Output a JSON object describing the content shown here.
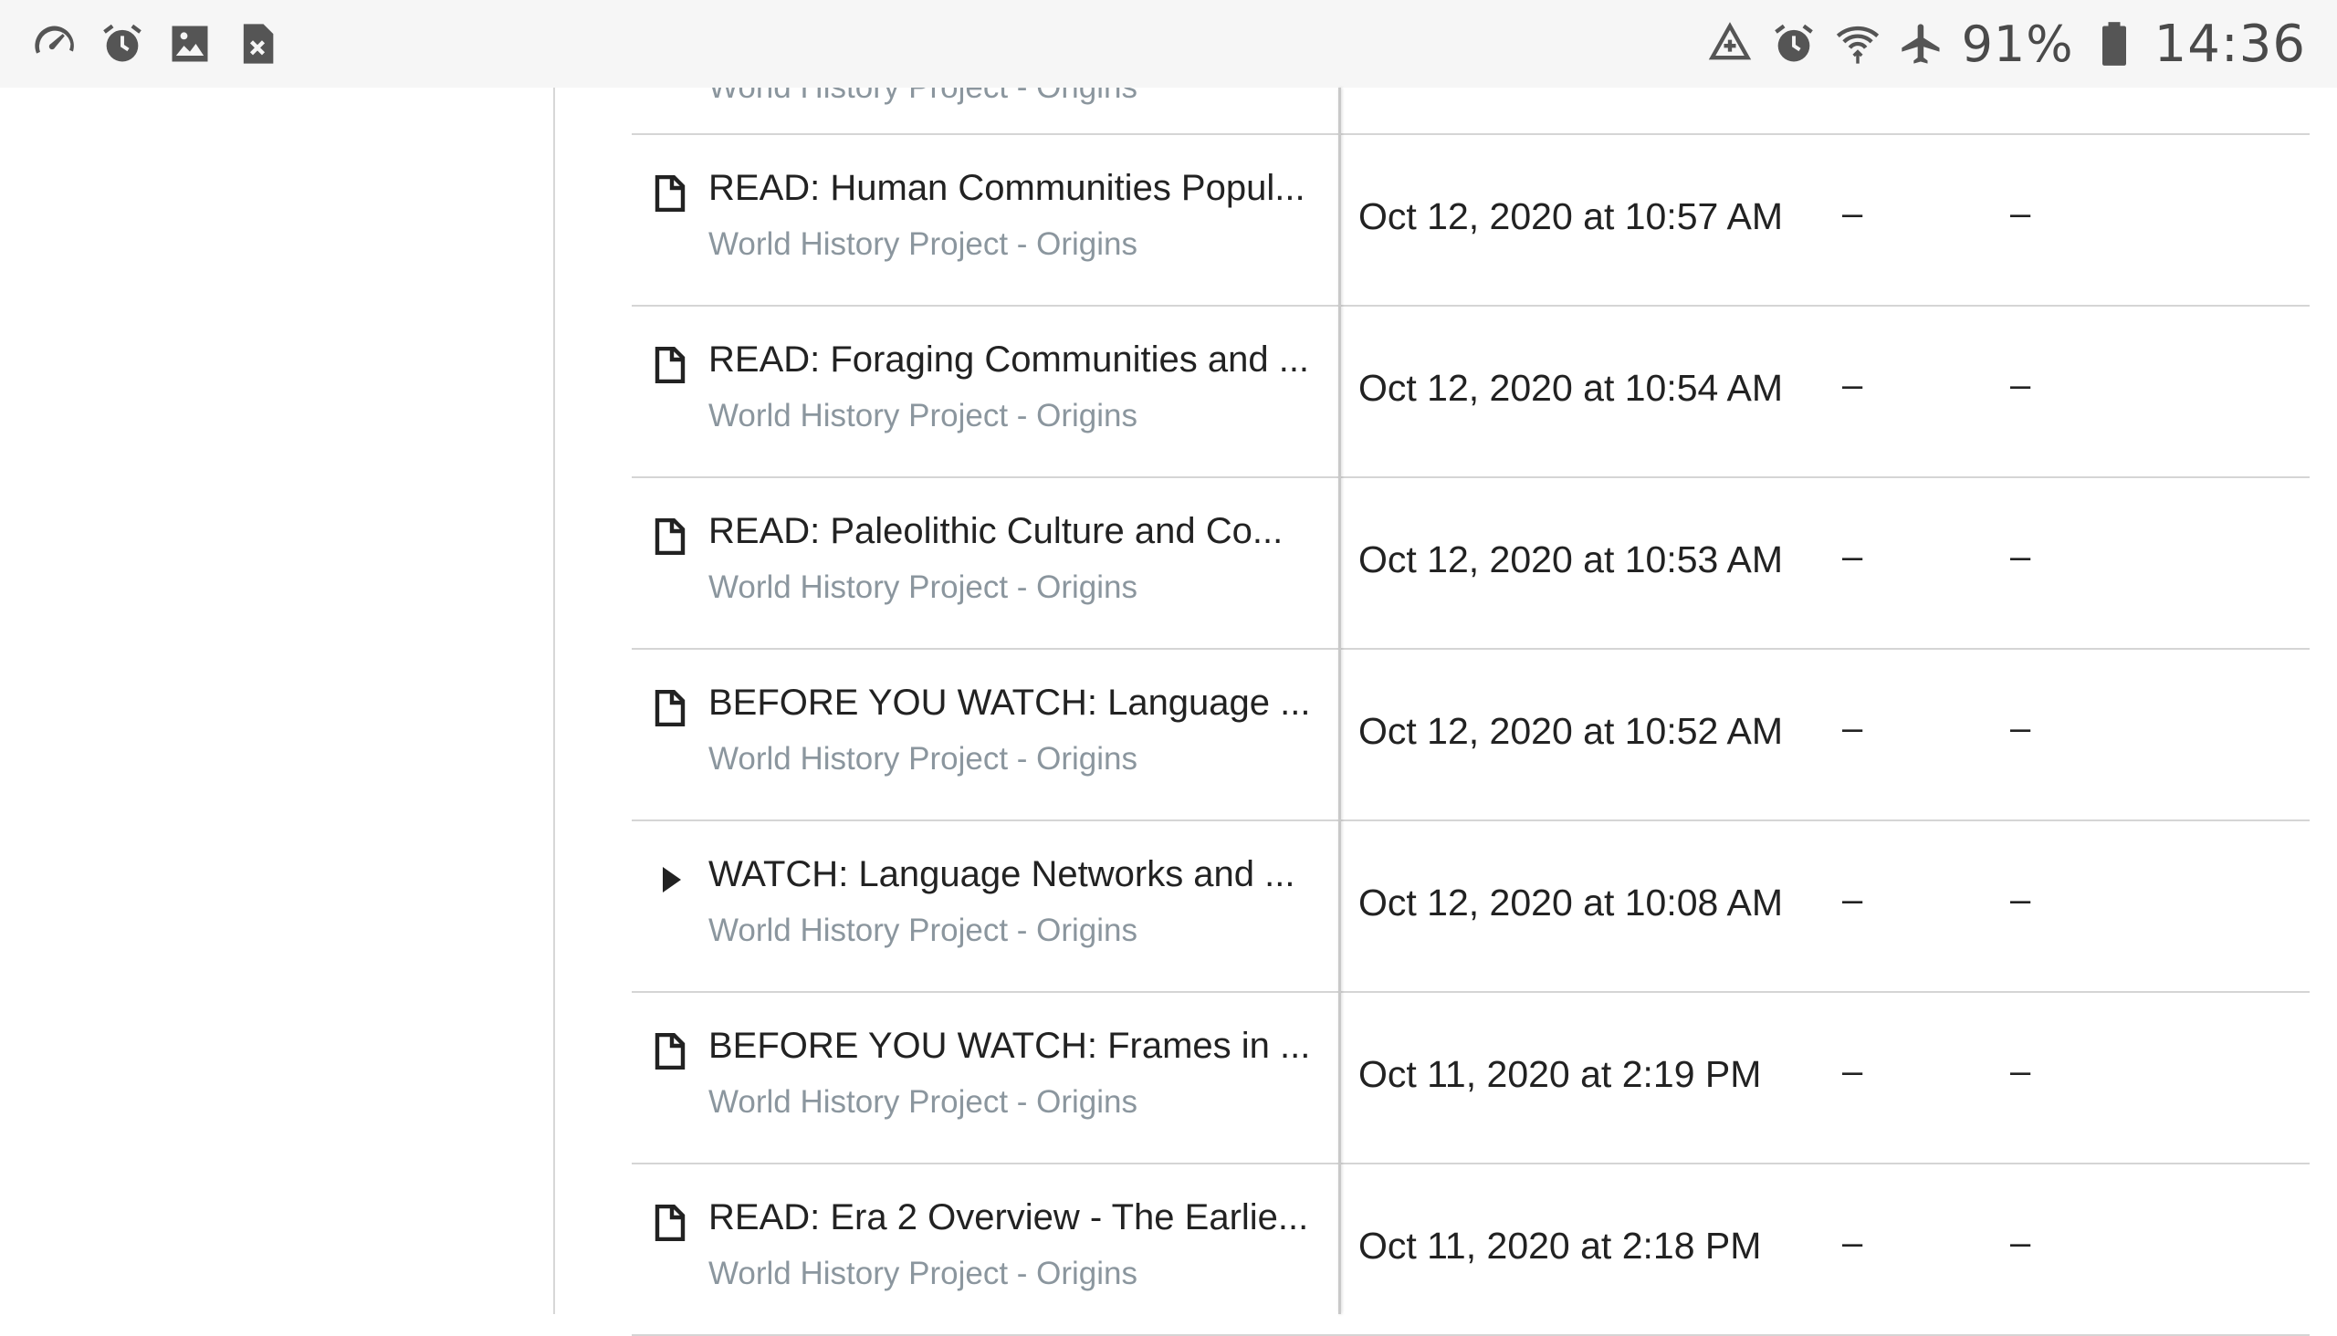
{
  "status_bar": {
    "left_icons": [
      "speedometer-icon",
      "alarm-icon",
      "gallery-icon",
      "file-error-icon"
    ],
    "right_icons": [
      "data-saver-icon",
      "alarm-icon",
      "wifi-icon",
      "airplane-icon",
      "battery-icon"
    ],
    "battery": "91%",
    "time": "14:36"
  },
  "table": {
    "partial_row_subtitle": "World History Project - Origins",
    "rows": [
      {
        "icon": "document-icon",
        "title": "READ: Human Communities Popul...",
        "subtitle": "World History Project - Origins",
        "date": "Oct 12, 2020 at 10:57 AM",
        "col2": "–",
        "col3": "–"
      },
      {
        "icon": "document-icon",
        "title": "READ: Foraging Communities and ...",
        "subtitle": "World History Project - Origins",
        "date": "Oct 12, 2020 at 10:54 AM",
        "col2": "–",
        "col3": "–"
      },
      {
        "icon": "document-icon",
        "title": "READ: Paleolithic Culture and Co...",
        "subtitle": "World History Project - Origins",
        "date": "Oct 12, 2020 at 10:53 AM",
        "col2": "–",
        "col3": "–"
      },
      {
        "icon": "document-icon",
        "title": "BEFORE YOU WATCH: Language ...",
        "subtitle": "World History Project - Origins",
        "date": "Oct 12, 2020 at 10:52 AM",
        "col2": "–",
        "col3": "–"
      },
      {
        "icon": "play-icon",
        "title": "WATCH: Language Networks and ...",
        "subtitle": "World History Project - Origins",
        "date": "Oct 12, 2020 at 10:08 AM",
        "col2": "–",
        "col3": "–"
      },
      {
        "icon": "document-icon",
        "title": "BEFORE YOU WATCH: Frames in ...",
        "subtitle": "World History Project - Origins",
        "date": "Oct 11, 2020 at 2:19 PM",
        "col2": "–",
        "col3": "–"
      },
      {
        "icon": "document-icon",
        "title": "READ: Era 2 Overview - The Earlie...",
        "subtitle": "World History Project - Origins",
        "date": "Oct 11, 2020 at 2:18 PM",
        "col2": "–",
        "col3": "–"
      }
    ]
  }
}
